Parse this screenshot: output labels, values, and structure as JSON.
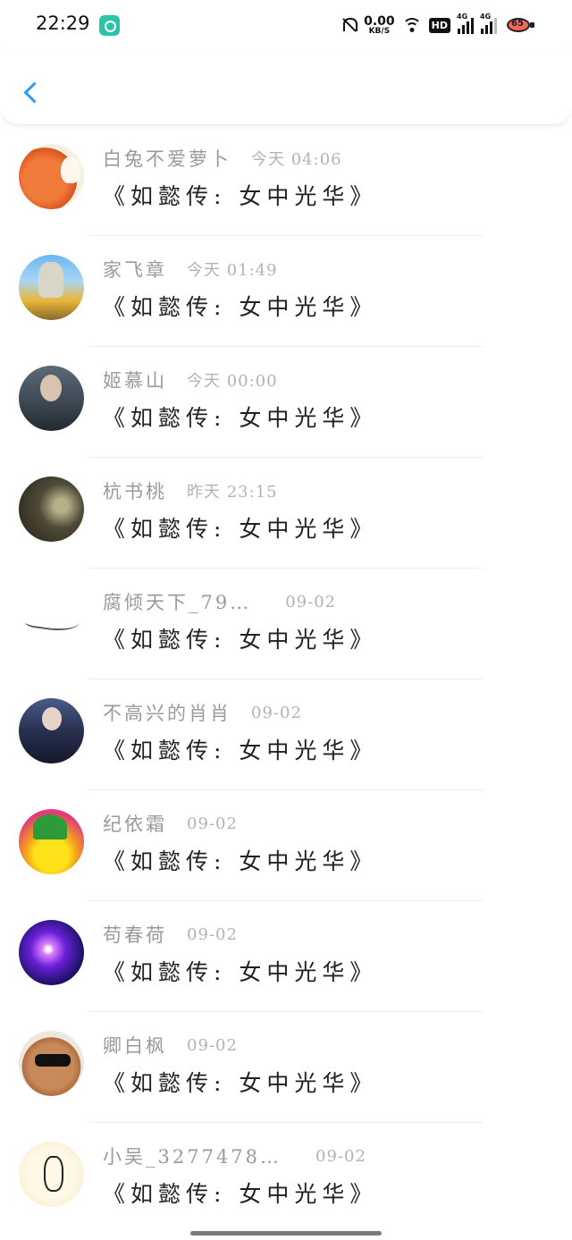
{
  "status_bar": {
    "time": "22:29",
    "net_speed": "0.00",
    "net_unit": "KB/S",
    "hd_badge": "HD",
    "signal1": "4G",
    "signal2": "4G",
    "battery": "65"
  },
  "header": {
    "back_icon": "chevron-left-icon",
    "accent_color": "#2d9cf0"
  },
  "messages": [
    {
      "username": "白兔不爱萝卜",
      "time": "今天 04:06",
      "text": "《如懿传: 女中光华》"
    },
    {
      "username": "家飞章",
      "time": "今天 01:49",
      "text": "《如懿传: 女中光华》"
    },
    {
      "username": "姬慕山",
      "time": "今天 00:00",
      "text": "《如懿传: 女中光华》"
    },
    {
      "username": "杭书桃",
      "time": "昨天 23:15",
      "text": "《如懿传: 女中光华》"
    },
    {
      "username": "腐倾天下_79…",
      "time": "09-02",
      "text": "《如懿传: 女中光华》"
    },
    {
      "username": "不高兴的肖肖",
      "time": "09-02",
      "text": "《如懿传: 女中光华》"
    },
    {
      "username": "纪依霜",
      "time": "09-02",
      "text": "《如懿传: 女中光华》"
    },
    {
      "username": "苟春荷",
      "time": "09-02",
      "text": "《如懿传: 女中光华》"
    },
    {
      "username": "卿白枫",
      "time": "09-02",
      "text": "《如懿传: 女中光华》"
    },
    {
      "username": "小吴_3277478…",
      "time": "09-02",
      "text": "《如懿传: 女中光华》"
    }
  ]
}
